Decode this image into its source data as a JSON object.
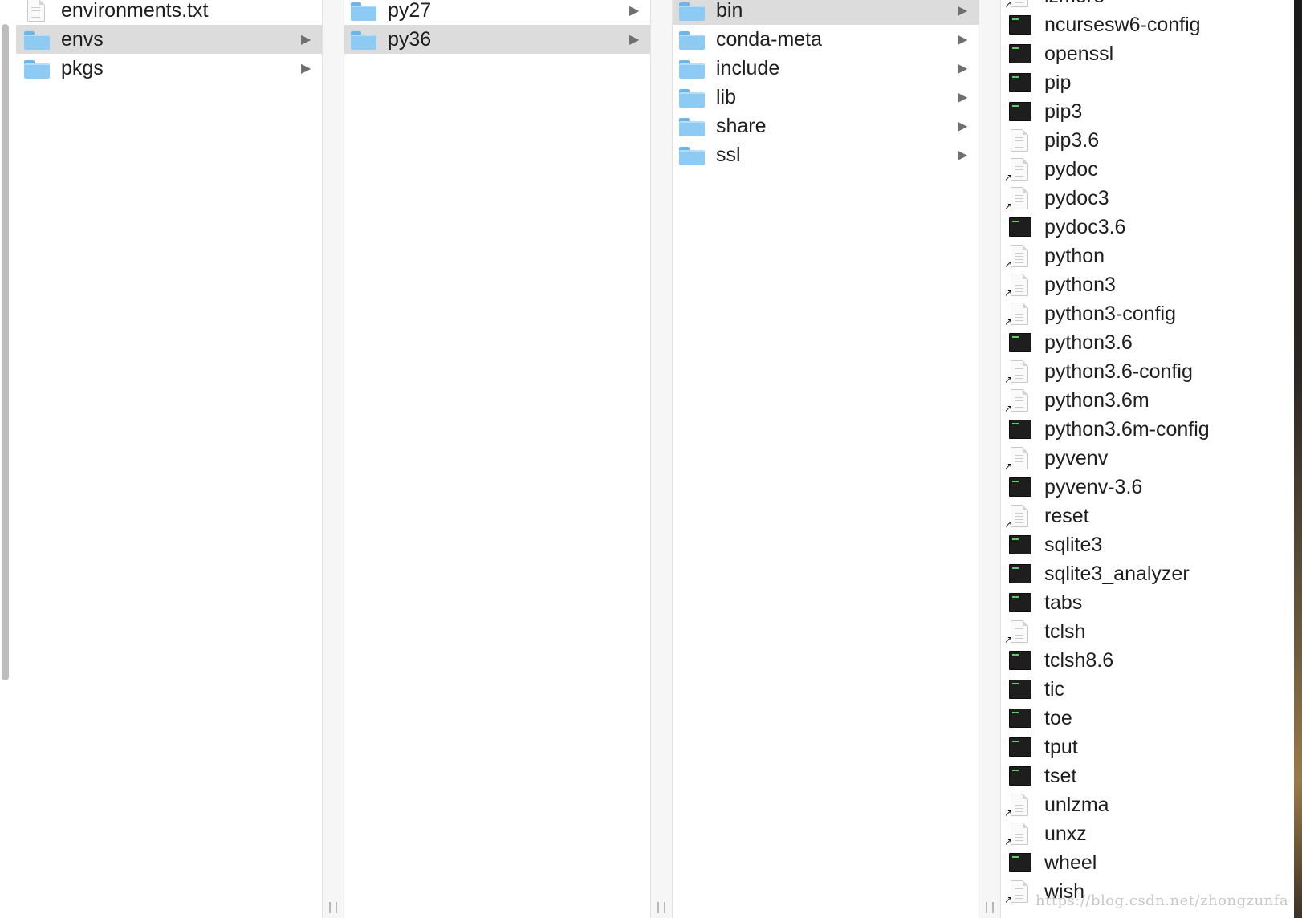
{
  "columns": [
    {
      "id": "col1",
      "items": [
        {
          "label": "environments.txt",
          "kind": "doc",
          "alias": false,
          "folder": false,
          "selected": false
        },
        {
          "label": "envs",
          "kind": "folder",
          "alias": false,
          "folder": true,
          "selected": true
        },
        {
          "label": "pkgs",
          "kind": "folder",
          "alias": false,
          "folder": true,
          "selected": false
        }
      ]
    },
    {
      "id": "col2",
      "items": [
        {
          "label": "py27",
          "kind": "folder",
          "alias": false,
          "folder": true,
          "selected": false
        },
        {
          "label": "py36",
          "kind": "folder",
          "alias": false,
          "folder": true,
          "selected": true
        }
      ]
    },
    {
      "id": "col3",
      "items": [
        {
          "label": "bin",
          "kind": "folder",
          "alias": false,
          "folder": true,
          "selected": true
        },
        {
          "label": "conda-meta",
          "kind": "folder",
          "alias": false,
          "folder": true,
          "selected": false
        },
        {
          "label": "include",
          "kind": "folder",
          "alias": false,
          "folder": true,
          "selected": false
        },
        {
          "label": "lib",
          "kind": "folder",
          "alias": false,
          "folder": true,
          "selected": false
        },
        {
          "label": "share",
          "kind": "folder",
          "alias": false,
          "folder": true,
          "selected": false
        },
        {
          "label": "ssl",
          "kind": "folder",
          "alias": false,
          "folder": true,
          "selected": false
        }
      ]
    },
    {
      "id": "col4",
      "items": [
        {
          "label": "lzmore",
          "kind": "doc",
          "alias": true,
          "folder": false,
          "selected": false
        },
        {
          "label": "ncursesw6-config",
          "kind": "exec",
          "alias": false,
          "folder": false,
          "selected": false
        },
        {
          "label": "openssl",
          "kind": "exec",
          "alias": false,
          "folder": false,
          "selected": false
        },
        {
          "label": "pip",
          "kind": "exec",
          "alias": false,
          "folder": false,
          "selected": false
        },
        {
          "label": "pip3",
          "kind": "exec",
          "alias": false,
          "folder": false,
          "selected": false
        },
        {
          "label": "pip3.6",
          "kind": "doc",
          "alias": false,
          "folder": false,
          "selected": false
        },
        {
          "label": "pydoc",
          "kind": "doc",
          "alias": true,
          "folder": false,
          "selected": false
        },
        {
          "label": "pydoc3",
          "kind": "doc",
          "alias": true,
          "folder": false,
          "selected": false
        },
        {
          "label": "pydoc3.6",
          "kind": "exec",
          "alias": false,
          "folder": false,
          "selected": false
        },
        {
          "label": "python",
          "kind": "doc",
          "alias": true,
          "folder": false,
          "selected": false
        },
        {
          "label": "python3",
          "kind": "doc",
          "alias": true,
          "folder": false,
          "selected": false
        },
        {
          "label": "python3-config",
          "kind": "doc",
          "alias": true,
          "folder": false,
          "selected": false
        },
        {
          "label": "python3.6",
          "kind": "exec",
          "alias": false,
          "folder": false,
          "selected": false
        },
        {
          "label": "python3.6-config",
          "kind": "doc",
          "alias": true,
          "folder": false,
          "selected": false
        },
        {
          "label": "python3.6m",
          "kind": "doc",
          "alias": true,
          "folder": false,
          "selected": false
        },
        {
          "label": "python3.6m-config",
          "kind": "exec",
          "alias": false,
          "folder": false,
          "selected": false
        },
        {
          "label": "pyvenv",
          "kind": "doc",
          "alias": true,
          "folder": false,
          "selected": false
        },
        {
          "label": "pyvenv-3.6",
          "kind": "exec",
          "alias": false,
          "folder": false,
          "selected": false
        },
        {
          "label": "reset",
          "kind": "doc",
          "alias": true,
          "folder": false,
          "selected": false
        },
        {
          "label": "sqlite3",
          "kind": "exec",
          "alias": false,
          "folder": false,
          "selected": false
        },
        {
          "label": "sqlite3_analyzer",
          "kind": "exec",
          "alias": false,
          "folder": false,
          "selected": false
        },
        {
          "label": "tabs",
          "kind": "exec",
          "alias": false,
          "folder": false,
          "selected": false
        },
        {
          "label": "tclsh",
          "kind": "doc",
          "alias": true,
          "folder": false,
          "selected": false
        },
        {
          "label": "tclsh8.6",
          "kind": "exec",
          "alias": false,
          "folder": false,
          "selected": false
        },
        {
          "label": "tic",
          "kind": "exec",
          "alias": false,
          "folder": false,
          "selected": false
        },
        {
          "label": "toe",
          "kind": "exec",
          "alias": false,
          "folder": false,
          "selected": false
        },
        {
          "label": "tput",
          "kind": "exec",
          "alias": false,
          "folder": false,
          "selected": false
        },
        {
          "label": "tset",
          "kind": "exec",
          "alias": false,
          "folder": false,
          "selected": false
        },
        {
          "label": "unlzma",
          "kind": "doc",
          "alias": true,
          "folder": false,
          "selected": false
        },
        {
          "label": "unxz",
          "kind": "doc",
          "alias": true,
          "folder": false,
          "selected": false
        },
        {
          "label": "wheel",
          "kind": "exec",
          "alias": false,
          "folder": false,
          "selected": false
        },
        {
          "label": "wish",
          "kind": "doc",
          "alias": true,
          "folder": false,
          "selected": false
        }
      ]
    }
  ],
  "watermark": "https://blog.csdn.net/zhongzunfa",
  "colors": {
    "selection": "#dcdcdc",
    "folder": "#8ecbf4",
    "exec": "#1e1e1e"
  }
}
